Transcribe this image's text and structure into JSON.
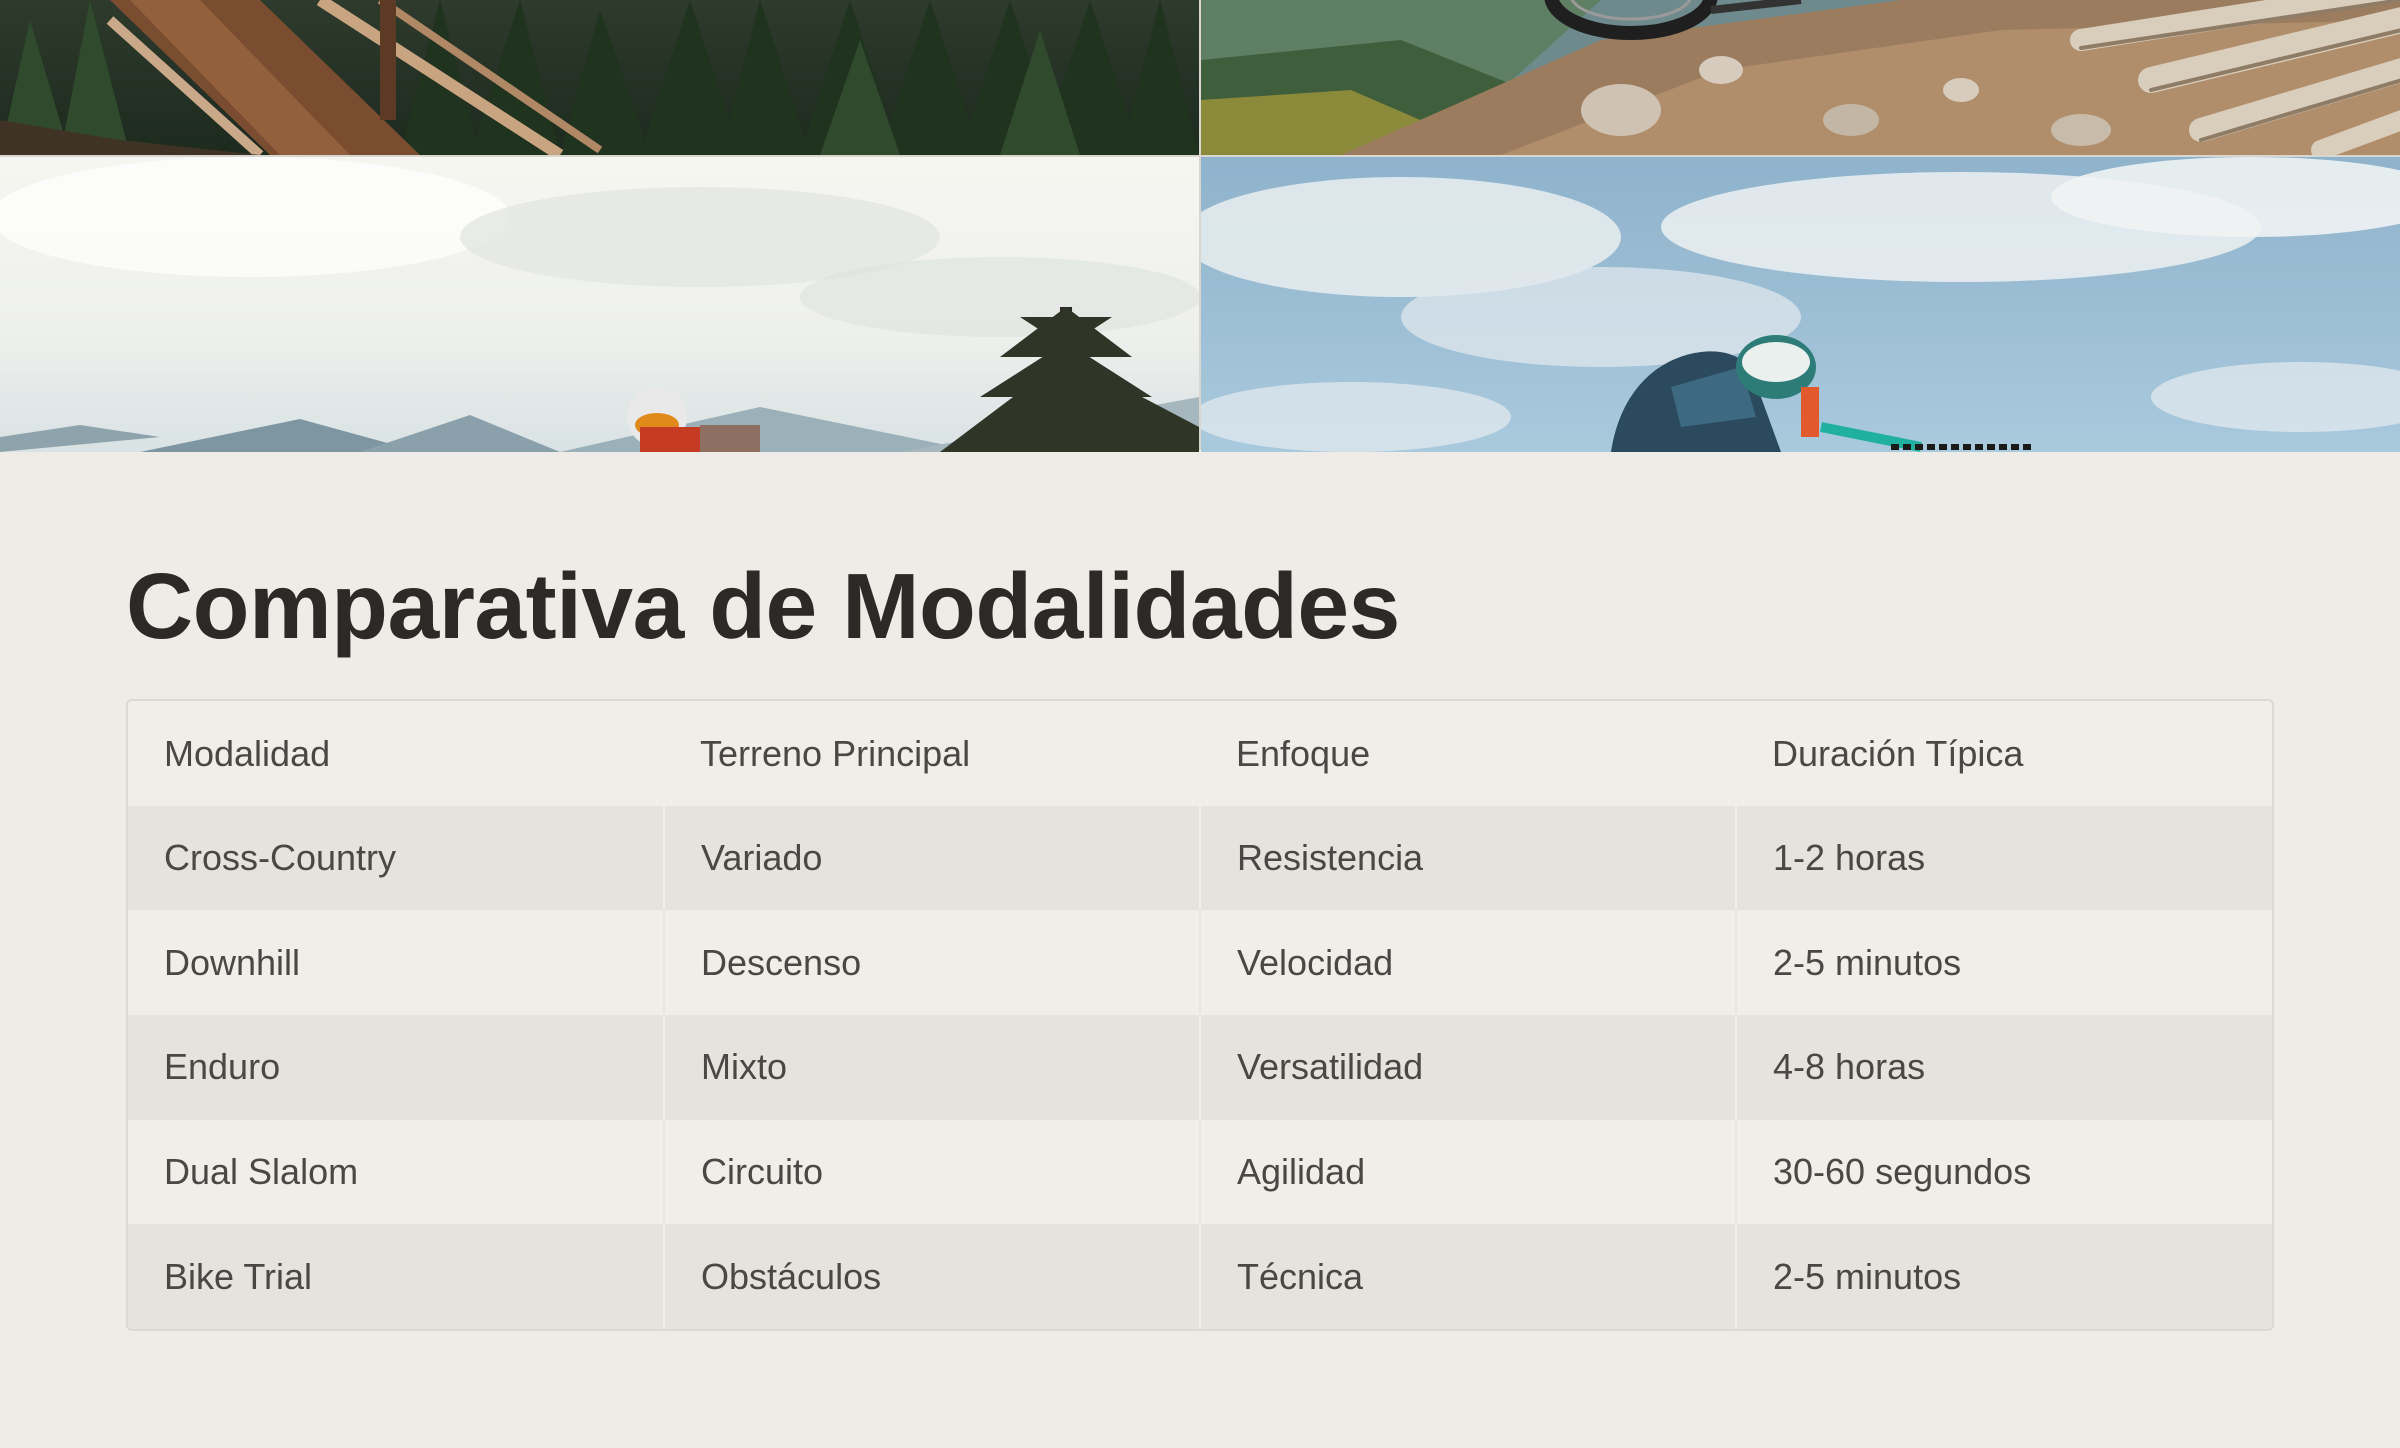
{
  "photos": [
    {
      "name": "wooden-ramp-forest-photo"
    },
    {
      "name": "rocky-trail-bike-photo"
    },
    {
      "name": "rider-mountains-photo"
    },
    {
      "name": "rider-sky-photo"
    }
  ],
  "page_title": "Comparativa de Modalidades",
  "table": {
    "headers": [
      "Modalidad",
      "Terreno Principal",
      "Enfoque",
      "Duración Típica"
    ],
    "rows": [
      [
        "Cross-Country",
        "Variado",
        "Resistencia",
        "1-2 horas"
      ],
      [
        "Downhill",
        "Descenso",
        "Velocidad",
        "2-5 minutos"
      ],
      [
        "Enduro",
        "Mixto",
        "Versatilidad",
        "4-8 horas"
      ],
      [
        "Dual Slalom",
        "Circuito",
        "Agilidad",
        "30-60 segundos"
      ],
      [
        "Bike Trial",
        "Obstáculos",
        "Técnica",
        "2-5 minutos"
      ]
    ]
  },
  "colors": {
    "background": "#efece8",
    "title": "#2b2a27",
    "cell_text": "#4a4845",
    "row_dark": "#e6e3de",
    "row_light": "#f1eeea"
  }
}
